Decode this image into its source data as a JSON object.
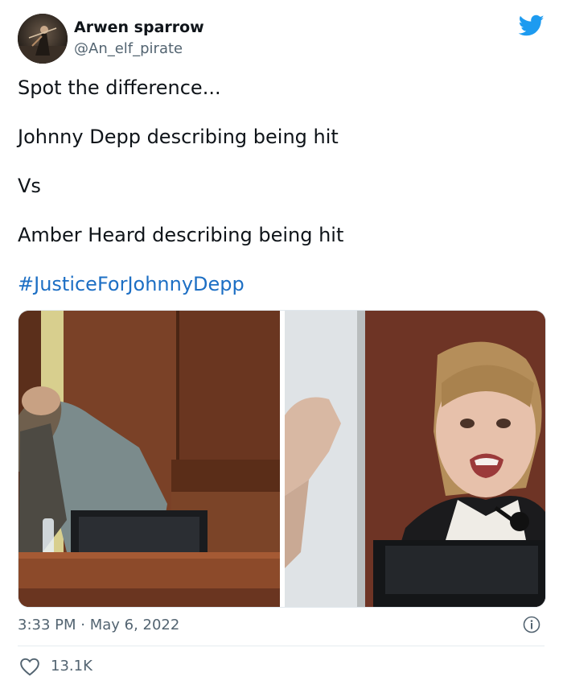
{
  "author": {
    "display_name": "Arwen sparrow",
    "handle": "@An_elf_pirate",
    "avatar_icon": "avatar-image"
  },
  "platform_icon": "twitter-bird-icon",
  "brand_color": "#1d9bf0",
  "link_color": "#1d6fc4",
  "body": {
    "line1": "Spot the difference...",
    "line2": "Johnny Depp describing being hit",
    "line3": "Vs",
    "line4": "Amber Heard describing being hit",
    "hashtag": "#JusticeForJohnnyDepp"
  },
  "media": {
    "photo_left_icon": "courtroom-photo-man-covering-head",
    "photo_right_icon": "courtroom-photo-woman-testifying"
  },
  "footer": {
    "timestamp": "3:33 PM · May 6, 2022",
    "info_icon": "info-icon",
    "like_icon": "heart-icon",
    "like_count": "13.1K"
  }
}
